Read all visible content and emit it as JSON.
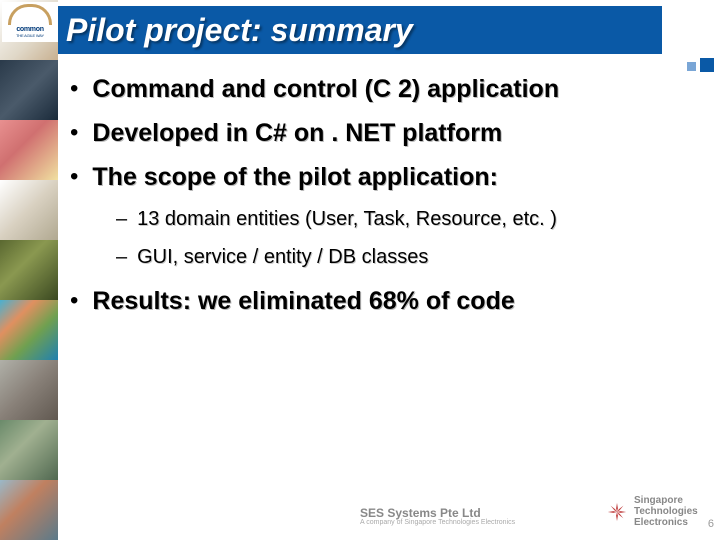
{
  "logo": {
    "name": "common",
    "sub": "THE AGILE WAY"
  },
  "title": "Pilot project: summary",
  "bullets": [
    {
      "level": 1,
      "text": "Command and control (C 2) application"
    },
    {
      "level": 1,
      "text": "Developed in C# on . NET platform"
    },
    {
      "level": 1,
      "text": "The scope of the pilot application:"
    },
    {
      "level": 2,
      "text": "13 domain entities (User, Task, Resource, etc. )"
    },
    {
      "level": 2,
      "text": "GUI, service / entity / DB classes"
    },
    {
      "level": 1,
      "text": "Results: we eliminated 68% of code"
    }
  ],
  "footer": {
    "company1": {
      "name": "SES Systems Pte Ltd",
      "sub": "A company of Singapore Technologies Electronics"
    },
    "company2": {
      "line1": "Singapore Technologies",
      "line2": "Electronics"
    },
    "page": "6"
  },
  "strip_colors": [
    "linear-gradient(135deg,#fff 0%,#e0d8c8 60%,#c8b090 100%)",
    "linear-gradient(135deg,#2a3a4a 0%,#4a5a6a 50%,#1a2a3a 100%)",
    "linear-gradient(135deg,#e89090 0%,#d07070 40%,#f0e0a0 100%)",
    "linear-gradient(135deg,#fff 0%,#d8d0c0 50%,#b0a890 100%)",
    "linear-gradient(135deg,#5a6830 0%,#8a9850 40%,#3a4820 100%)",
    "linear-gradient(135deg,#4ab0d0 0%,#e09060 30%,#70a050 60%,#2080b0 100%)",
    "linear-gradient(135deg,#b0b0a8 0%,#888078 50%,#605850 100%)",
    "linear-gradient(135deg,#6a8a6a 0%,#a0b090 40%,#506850 100%)",
    "linear-gradient(135deg,#9ab8c8 0%,#c08060 40%,#5a7a8a 100%)"
  ]
}
